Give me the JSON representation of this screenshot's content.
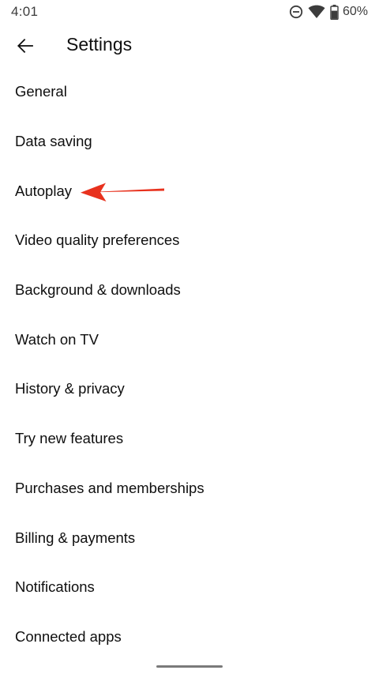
{
  "status_bar": {
    "time": "4:01",
    "battery_percent": "60%",
    "icons": [
      "do-not-disturb-icon",
      "wifi-icon",
      "battery-icon"
    ]
  },
  "header": {
    "title": "Settings",
    "back_icon": "back-arrow-icon"
  },
  "settings": {
    "items": [
      {
        "id": "general",
        "label": "General"
      },
      {
        "id": "data-saving",
        "label": "Data saving"
      },
      {
        "id": "autoplay",
        "label": "Autoplay"
      },
      {
        "id": "video-quality-preferences",
        "label": "Video quality preferences"
      },
      {
        "id": "background-downloads",
        "label": "Background & downloads"
      },
      {
        "id": "watch-on-tv",
        "label": "Watch on TV"
      },
      {
        "id": "history-privacy",
        "label": "History & privacy"
      },
      {
        "id": "try-new-features",
        "label": "Try new features"
      },
      {
        "id": "purchases-memberships",
        "label": "Purchases and memberships"
      },
      {
        "id": "billing-payments",
        "label": "Billing & payments"
      },
      {
        "id": "notifications",
        "label": "Notifications"
      },
      {
        "id": "connected-apps",
        "label": "Connected apps"
      }
    ]
  },
  "annotation": {
    "icon": "red-arrow-icon",
    "target": "autoplay",
    "color": "#e8321e"
  },
  "colors": {
    "background": "#ffffff",
    "text": "#0f0f0f",
    "status_text": "#3c3c3c"
  }
}
